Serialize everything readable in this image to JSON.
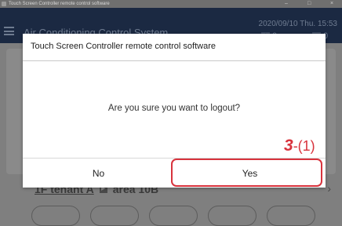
{
  "window": {
    "title": "Touch Screen Controller remote control software",
    "controls": [
      "–",
      "□",
      "×"
    ]
  },
  "header": {
    "app_name": "Air Conditioning Control System",
    "datetime": "2020/09/10 Thu. 15:53",
    "counters": [
      {
        "icon": "power-icon",
        "glyph": "⏻",
        "value": "0"
      },
      {
        "icon": "alert-icon",
        "glyph": "▲",
        "value": "0"
      }
    ]
  },
  "background": {
    "tenant": "1F tenant A",
    "area": "area 10B"
  },
  "dialog": {
    "title": "Touch Screen Controller  remote control software",
    "message": "Are you sure you want to logout?",
    "no_label": "No",
    "yes_label": "Yes"
  },
  "annotation": {
    "step": "3",
    "substep": "-(1)",
    "color": "#d8333d"
  }
}
